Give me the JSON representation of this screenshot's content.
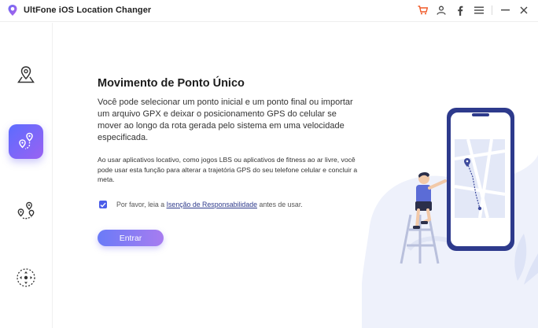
{
  "app": {
    "title": "UltFone iOS Location Changer"
  },
  "titlebar_icons": [
    "cart-icon",
    "user-icon",
    "facebook-icon",
    "menu-icon",
    "minimize-icon",
    "close-icon"
  ],
  "sidebar": {
    "items": [
      {
        "name": "change-location",
        "icon": "map-pin-icon",
        "active": false
      },
      {
        "name": "single-spot-movement",
        "icon": "route-pin-icon",
        "active": true
      },
      {
        "name": "multi-spot-movement",
        "icon": "multi-pin-icon",
        "active": false
      },
      {
        "name": "joystick-movement",
        "icon": "joystick-icon",
        "active": false
      }
    ]
  },
  "main": {
    "heading": "Movimento de Ponto Único",
    "description": "Você pode selecionar um ponto inicial e um ponto final ou importar um arquivo GPX e deixar o posicionamento GPS do celular se mover ao longo da rota gerada pelo sistema em uma velocidade especificada.",
    "note": "Ao usar aplicativos locativo, como jogos LBS ou aplicativos de fitness ao ar livre, você pode usar esta função para alterar a trajetória GPS do seu telefone celular e concluir a meta.",
    "agree": {
      "checked": true,
      "prefix": "Por favor, leia a",
      "link": "Isenção de Responsabilidade",
      "suffix": "antes de usar."
    },
    "enter_button": "Entrar"
  },
  "colors": {
    "accent_start": "#5c6cff",
    "accent_end": "#9a62f2",
    "checkbox": "#4b5de8",
    "link": "#2f3b8c",
    "titlebar_cart": "#f05a28"
  }
}
